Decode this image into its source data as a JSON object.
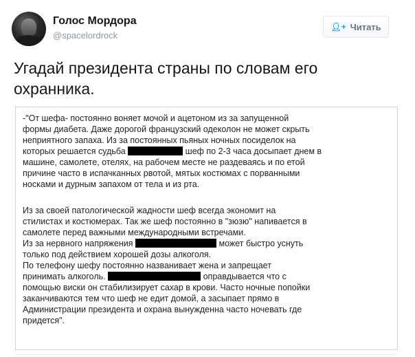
{
  "profile": {
    "display_name": "Голос Мордора",
    "handle": "@spacelordrock"
  },
  "follow_button": {
    "label": "Читать",
    "icon": "add-user-icon"
  },
  "tweet": {
    "text_line_1": "Угадай президента страны по словам его",
    "text_line_2": "охранника."
  },
  "quote_image": {
    "paragraph_1": [
      "-\"От шефа- постоянно воняет мочой и ацетоном из за запущенной",
      "формы диабета. Даже дорогой французский одеколон не может скрыть",
      "неприятного запаха. Из за постоянных пьяных ночных посиделок на",
      [
        "которых решается судьба",
        "шеф по 2-3 часа досыпает днем в"
      ],
      "машине, самолете, отелях, на рабочем месте не раздеваясь и по етой",
      "причине часто в испачканных рвотой, мятых костюмах с порванными",
      "носками и дурным запахом от тела и из рта."
    ],
    "paragraph_2": [
      "Из за своей патологической жадности шеф всегда экономит на",
      "стилистах и костюмерах. Так же шеф постоянно в \"зюзю\" напивается в",
      "самолете перед важными международными встречами.",
      [
        "Из за нервного напряжения",
        "может быстро уснуть"
      ],
      "только под действием хорошей дозы алкоголя.",
      "По телефону шефу постоянно названивает жена и запрещает",
      [
        "принимать алкоголь.",
        "оправдывается что с"
      ],
      "помощью виски он стабилизирует сахар в крови. Часто ночные попойки",
      "заканчиваются тем что шеф не едит домой, а засыпает прямо в",
      "Администрации президента и охрана вынужденна часто ночевать где",
      "придется\"."
    ]
  }
}
